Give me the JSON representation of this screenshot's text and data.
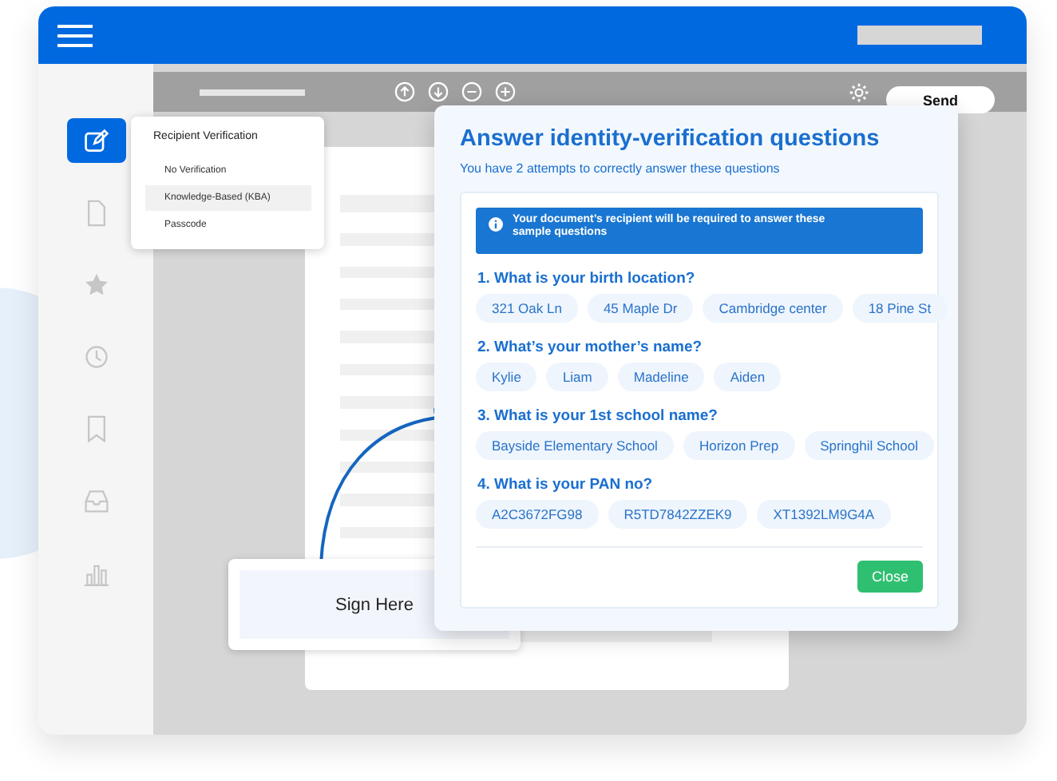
{
  "toolbar": {
    "send_button": "Send"
  },
  "sidebar": {
    "items": [
      {
        "kind": "edit",
        "selected": true
      },
      {
        "kind": "document",
        "selected": false
      },
      {
        "kind": "star",
        "selected": false
      },
      {
        "kind": "clock",
        "selected": false
      },
      {
        "kind": "bookmark",
        "selected": false
      },
      {
        "kind": "inbox",
        "selected": false
      },
      {
        "kind": "chart",
        "selected": false
      }
    ]
  },
  "verification_menu": {
    "title": "Recipient Verification",
    "items": [
      {
        "label": "No Verification",
        "selected": false
      },
      {
        "label": "Knowledge-Based (KBA)",
        "selected": true
      },
      {
        "label": "Passcode",
        "selected": false
      }
    ]
  },
  "dialog": {
    "title": "Answer identity-verification questions",
    "subtitle": "You have 2 attempts to correctly answer these questions",
    "notice": "Your document’s recipient will be required to answer these sample questions",
    "questions": [
      {
        "question": "1. What is your birth location?",
        "answers": [
          "321 Oak Ln",
          "45 Maple Dr",
          "Cambridge center",
          "18 Pine St"
        ]
      },
      {
        "question": "2. What’s your mother’s name?",
        "answers": [
          "Kylie",
          "Liam",
          "Madeline",
          "Aiden"
        ]
      },
      {
        "question": "3. What is your 1st school name?",
        "answers": [
          "Bayside Elementary School",
          "Horizon Prep",
          "Springhil School"
        ]
      },
      {
        "question": "4. What is your PAN no?",
        "answers": [
          "A2C3672FG98",
          "R5TD7842ZZEK9",
          "XT1392LM9G4A"
        ]
      }
    ],
    "close_button": "Close"
  },
  "sign_field": {
    "label": "Sign Here"
  }
}
